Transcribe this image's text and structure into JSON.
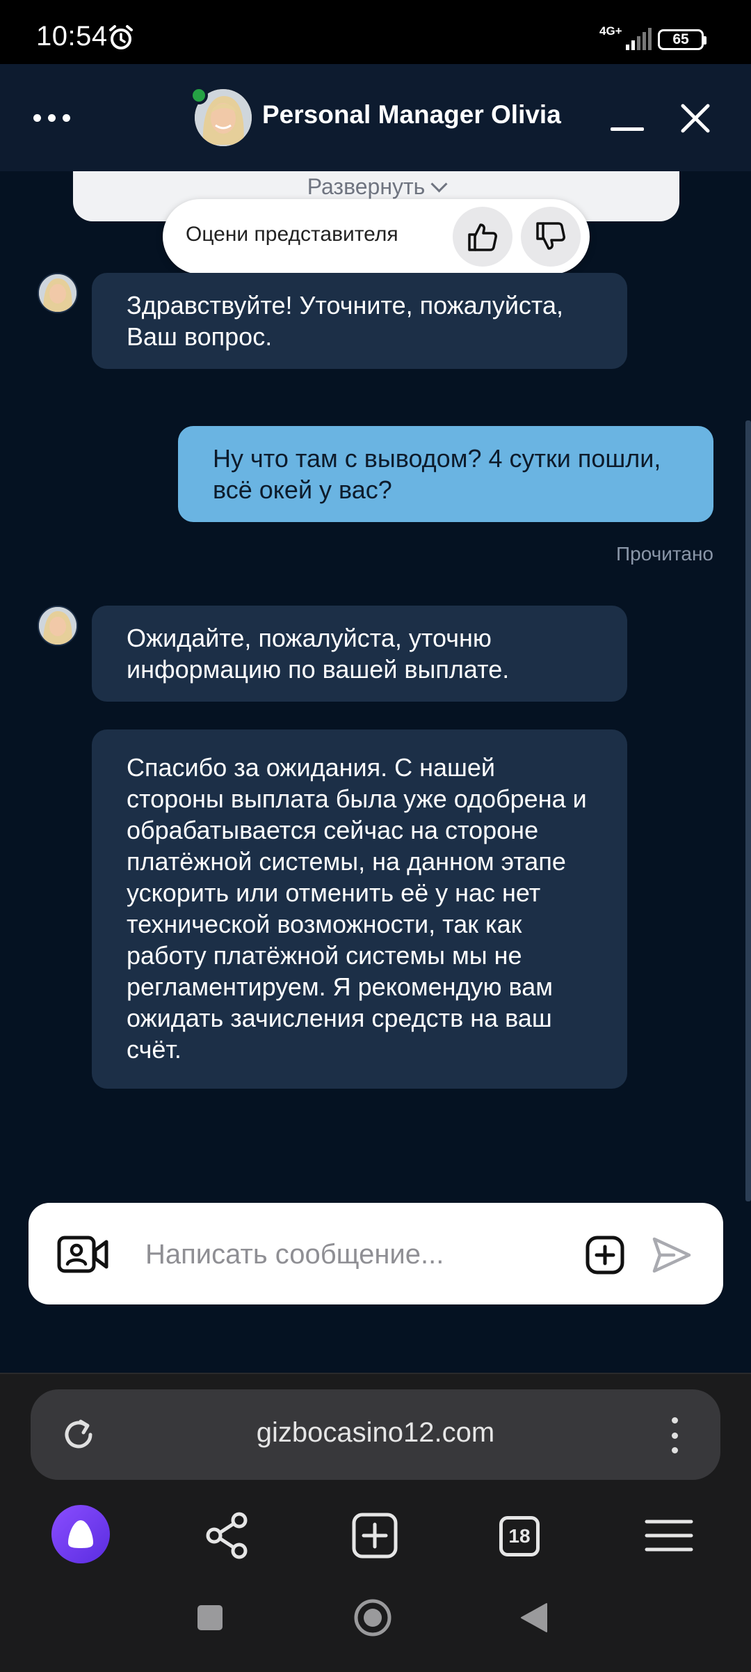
{
  "status_bar": {
    "time": "10:54",
    "network": "4G+",
    "battery": "65",
    "icons": [
      "alarm-icon",
      "signal-icon",
      "battery-icon"
    ]
  },
  "header": {
    "title": "Personal Manager Olivia",
    "online": true,
    "icons": [
      "more-icon",
      "minimize-icon",
      "close-icon"
    ]
  },
  "chat": {
    "expand_label": "Развернуть",
    "rating": {
      "label": "Оцени представителя",
      "icons": [
        "thumbs-up-icon",
        "thumbs-down-icon"
      ]
    },
    "messages": [
      {
        "from": "operator",
        "text": "Здравствуйте! Уточните, пожалуйста, Ваш вопрос."
      },
      {
        "from": "user",
        "text": "Ну что там с выводом? 4 сутки пошли, всё окей у вас?",
        "status": "Прочитано"
      },
      {
        "from": "operator",
        "text": "Ожидайте, пожалуйста, уточню информацию по вашей выплате."
      },
      {
        "from": "operator",
        "text": "Спасибо за ожидания. С нашей стороны выплата была уже одобрена и обрабатывается сейчас на стороне платёжной системы, на данном этапе ускорить или отменить её у нас нет технической возможности, так как работу платёжной системы мы не регламентируем. Я рекомендую вам ожидать зачисления средств на ваш счёт."
      }
    ]
  },
  "composer": {
    "placeholder": "Написать сообщение...",
    "value": "",
    "icons": [
      "video-call-icon",
      "attach-plus-icon",
      "send-icon"
    ]
  },
  "browser": {
    "url": "gizbocasino12.com",
    "tab_count": "18",
    "icons": [
      "reload-icon",
      "menu-dots-icon",
      "alice-icon",
      "share-icon",
      "new-tab-icon",
      "tabs-icon",
      "hamburger-menu-icon"
    ]
  },
  "system_nav": {
    "icons": [
      "recent-apps-icon",
      "home-icon",
      "back-icon"
    ]
  },
  "colors": {
    "background": "#051222",
    "header": "#0d1b2f",
    "operator_bubble": "#1c2f47",
    "user_bubble": "#6ab4e2",
    "online": "#25a244",
    "alice_accent": "#7b3cf5"
  }
}
